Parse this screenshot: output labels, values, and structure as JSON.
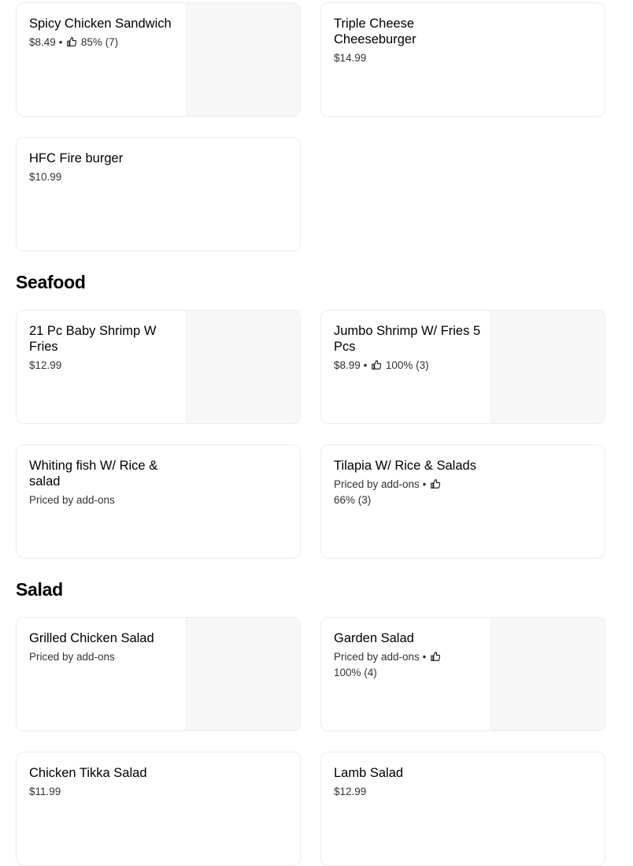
{
  "sections": {
    "seafood": {
      "title": "Seafood"
    },
    "salad": {
      "title": "Salad"
    }
  },
  "items": {
    "spicy_chicken": {
      "name": "Spicy Chicken Sandwich",
      "price": "$8.49",
      "rating": "85% (7)"
    },
    "triple_cheese": {
      "name": "Triple Cheese Cheeseburger",
      "price": "$14.99"
    },
    "hfc_fire": {
      "name": "HFC Fire burger",
      "price": "$10.99"
    },
    "baby_shrimp": {
      "name": "21 Pc Baby Shrimp W Fries",
      "price": "$12.99"
    },
    "jumbo_shrimp": {
      "name": "Jumbo Shrimp W/ Fries 5 Pcs",
      "price": "$8.99",
      "rating": "100% (3)"
    },
    "whiting_fish": {
      "name": "Whiting fish W/ Rice & salad",
      "price": "Priced by add-ons"
    },
    "tilapia": {
      "name": "Tilapia W/ Rice & Salads",
      "price": "Priced by add-ons",
      "rating": "66% (3)"
    },
    "grilled_chicken_salad": {
      "name": "Grilled Chicken Salad",
      "price": "Priced by add-ons"
    },
    "garden_salad": {
      "name": "Garden Salad",
      "price": "Priced by add-ons",
      "rating": "100% (4)"
    },
    "chicken_tikka_salad": {
      "name": "Chicken Tikka Salad",
      "price": "$11.99"
    },
    "lamb_salad": {
      "name": "Lamb Salad",
      "price": "$12.99"
    }
  },
  "separator": "•",
  "icons": {
    "rating": "thumbs-up-icon"
  }
}
